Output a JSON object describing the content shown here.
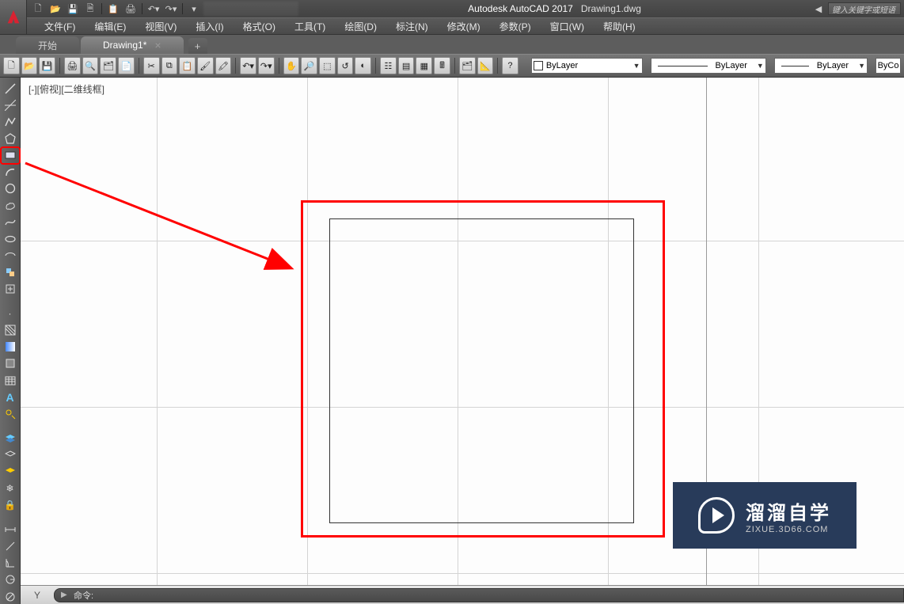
{
  "title": {
    "vendor": "Autodesk AutoCAD 2017",
    "file": "Drawing1.dwg"
  },
  "search_placeholder": "键入关键字或短语",
  "menu": [
    {
      "label": "文件(F)"
    },
    {
      "label": "编辑(E)"
    },
    {
      "label": "视图(V)"
    },
    {
      "label": "插入(I)"
    },
    {
      "label": "格式(O)"
    },
    {
      "label": "工具(T)"
    },
    {
      "label": "绘图(D)"
    },
    {
      "label": "标注(N)"
    },
    {
      "label": "修改(M)"
    },
    {
      "label": "参数(P)"
    },
    {
      "label": "窗口(W)"
    },
    {
      "label": "帮助(H)"
    }
  ],
  "tabs": [
    {
      "label": "开始",
      "active": false,
      "closable": false
    },
    {
      "label": "Drawing1*",
      "active": true,
      "closable": true
    }
  ],
  "toolbar_selects": {
    "layer_color": "ByLayer",
    "linetype": "ByLayer",
    "lineweight": "ByLayer",
    "bycolor": "ByCo"
  },
  "canvas": {
    "viewport_label": "[-][俯视][二维线框]"
  },
  "cmd": {
    "axis_label": "Y",
    "prompt": "命令:"
  },
  "watermark": {
    "cn": "溜溜自学",
    "en": "ZIXUE.3D66.COM"
  },
  "icons": {
    "new": "🗋",
    "open": "📂",
    "save": "💾",
    "print": "🖨",
    "undo": "↶",
    "redo": "↷",
    "cut": "✂",
    "copy": "⧉",
    "paste": "📋",
    "pan": "✋",
    "help": "?"
  }
}
